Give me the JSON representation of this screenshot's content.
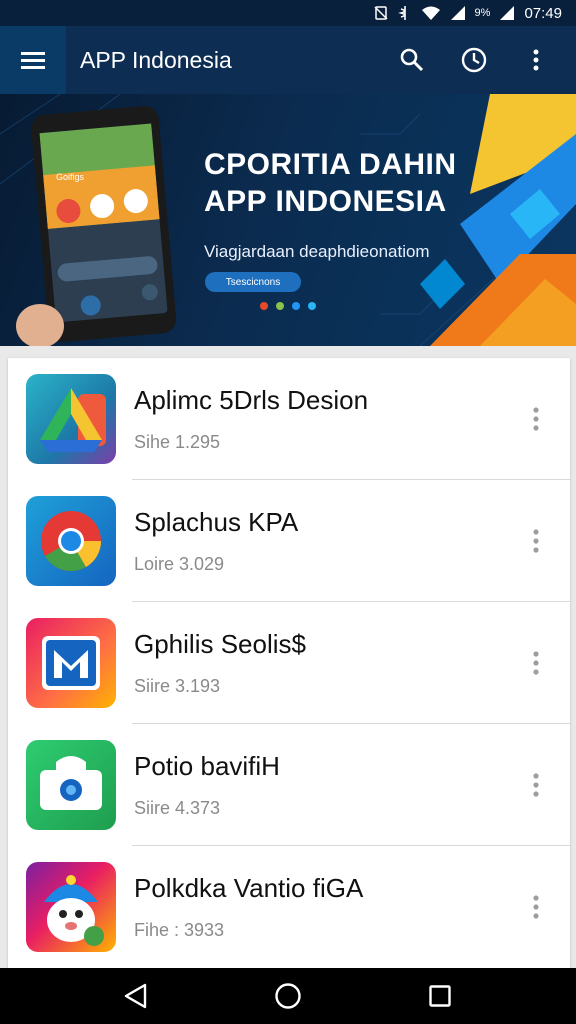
{
  "status_bar": {
    "battery_text": "9%",
    "time": "07:49"
  },
  "app_bar": {
    "title": "APP Indonesia"
  },
  "banner": {
    "title_line1": "CPORITIA DAHIN",
    "title_line2": "APP INDONESIA",
    "subtitle": "Viagjardaan deaphdieonatiom",
    "button_label": "Tsescicnons",
    "phone_label": "Goifigs",
    "dots": [
      "#e8492a",
      "#8bc34a",
      "#2196f3",
      "#29b6f6"
    ]
  },
  "apps": [
    {
      "name": "Aplimc 5Drls Desion",
      "size": "Sihe 1.295",
      "icon": "google-drive-icon"
    },
    {
      "name": "Splachus KPA",
      "size": "Loire 3.029",
      "icon": "chrome-icon"
    },
    {
      "name": "Gphilis Seolis$",
      "size": "Siire 3.193",
      "icon": "gmail-m-icon"
    },
    {
      "name": "Potio bavifiH",
      "size": "Siire 4.373",
      "icon": "camera-app-icon"
    },
    {
      "name": "Polkdka Vantio fiGA",
      "size": "Fihe : 3933",
      "icon": "mascot-game-icon"
    }
  ],
  "nav": {
    "back": "back-icon",
    "home": "home-icon",
    "recents": "recents-icon"
  }
}
